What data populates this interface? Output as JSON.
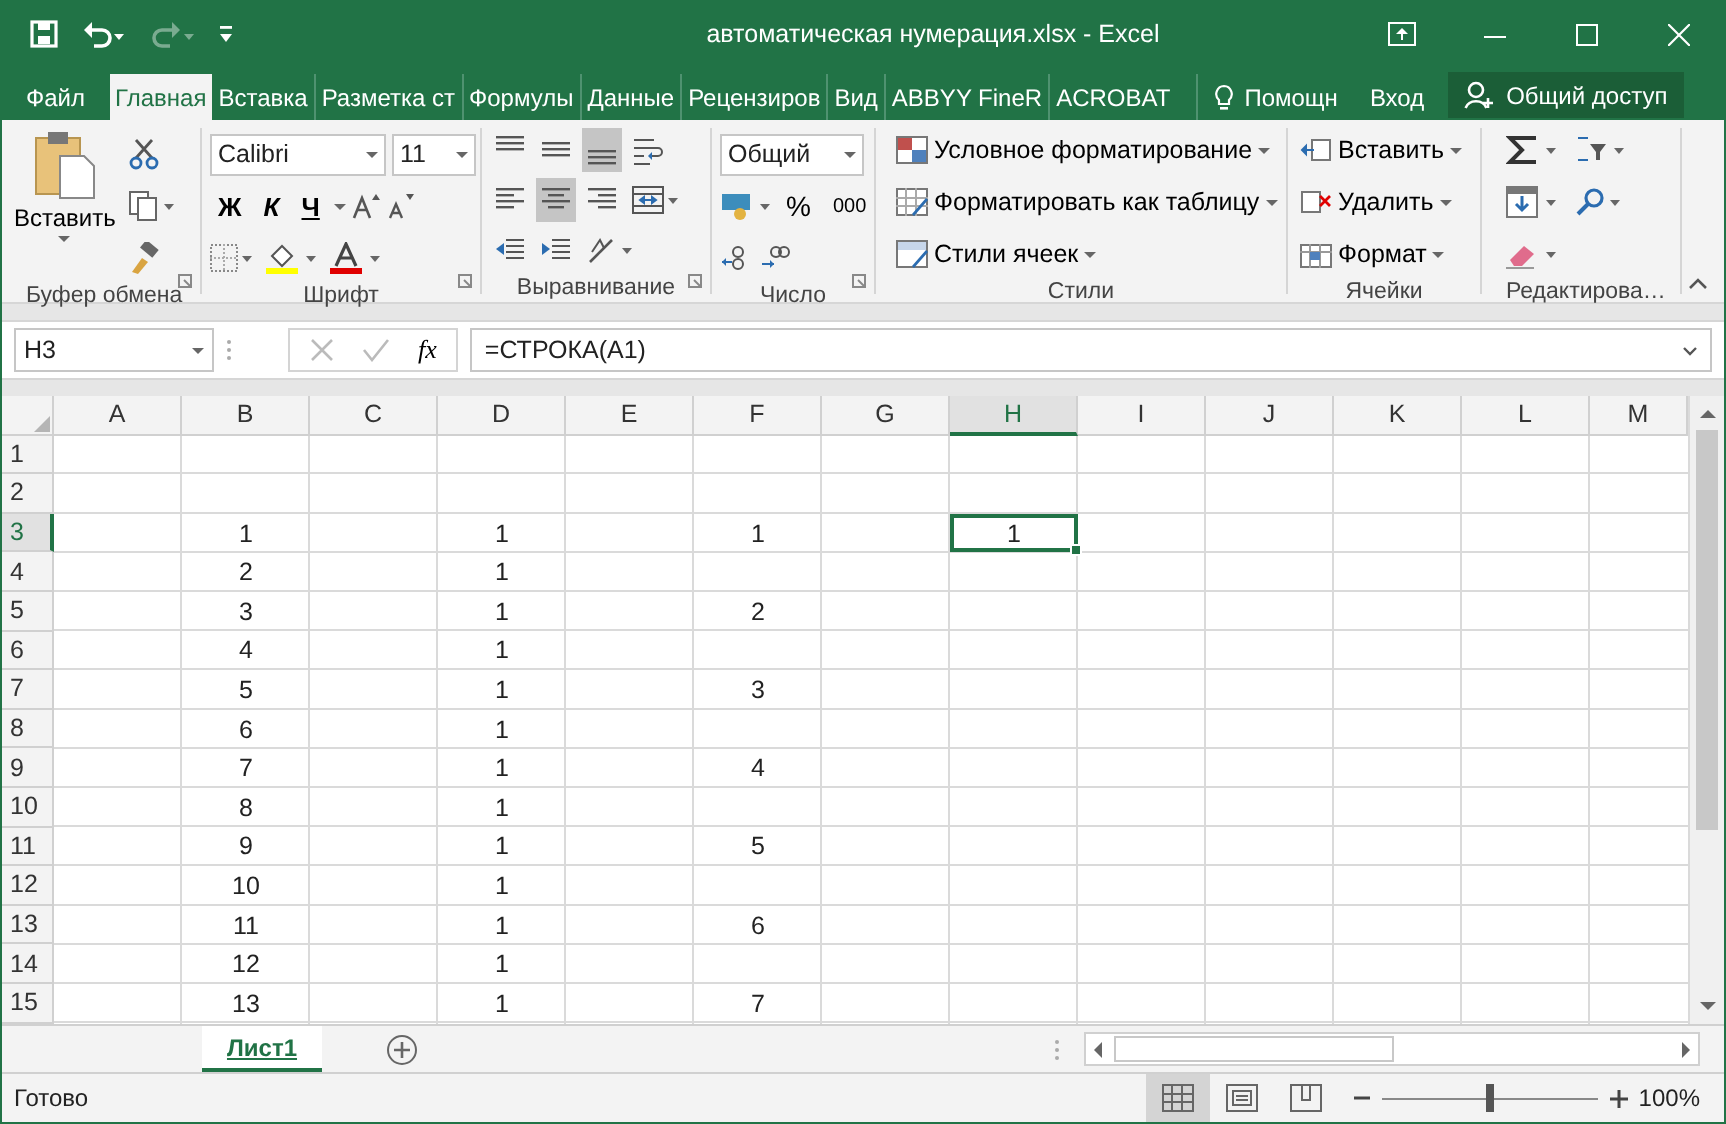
{
  "title_bar": {
    "title": "автоматическая нумерация.xlsx - Excel",
    "redo_disabled": true
  },
  "ribbon_tabs": [
    {
      "label": "Файл",
      "selected": false
    },
    {
      "label": "Главная",
      "selected": true
    },
    {
      "label": "Вставка",
      "selected": false
    },
    {
      "label": "Разметка ст",
      "selected": false
    },
    {
      "label": "Формулы",
      "selected": false
    },
    {
      "label": "Данные",
      "selected": false
    },
    {
      "label": "Рецензиров",
      "selected": false
    },
    {
      "label": "Вид",
      "selected": false
    },
    {
      "label": "ABBYY FineR",
      "selected": false
    },
    {
      "label": "ACROBAT",
      "selected": false
    }
  ],
  "tell_me": "Помощн",
  "sign_in": "Вход",
  "share": "Общий доступ",
  "ribbon": {
    "clipboard": {
      "paste": "Вставить",
      "label": "Буфер обмена"
    },
    "font": {
      "name": "Calibri",
      "size": "11",
      "bold": "Ж",
      "italic": "К",
      "underline": "Ч",
      "label": "Шрифт"
    },
    "alignment": {
      "vertical": [
        {
          "kind": "top",
          "selected": false
        },
        {
          "kind": "middle",
          "selected": false
        },
        {
          "kind": "bottom",
          "selected": true
        }
      ],
      "horizontal": [
        {
          "kind": "left",
          "selected": false
        },
        {
          "kind": "center",
          "selected": true
        },
        {
          "kind": "right",
          "selected": false
        }
      ],
      "label": "Выравнивание"
    },
    "number": {
      "format": "Общий",
      "percent": "%",
      "thousands": "000",
      "label": "Число"
    },
    "styles": {
      "items": [
        "Условное форматирование",
        "Форматировать как таблицу",
        "Стили ячеек"
      ],
      "label": "Стили"
    },
    "cells": {
      "items": [
        "Вставить",
        "Удалить",
        "Формат"
      ],
      "label": "Ячейки"
    },
    "editing": {
      "label": "Редактирова…"
    }
  },
  "formula_bar": {
    "name_box": "H3",
    "fx": "fx",
    "formula": "=СТРОКА(A1)"
  },
  "sheet": {
    "columns": [
      {
        "label": "A",
        "selected": false
      },
      {
        "label": "B",
        "selected": false
      },
      {
        "label": "C",
        "selected": false
      },
      {
        "label": "D",
        "selected": false
      },
      {
        "label": "E",
        "selected": false
      },
      {
        "label": "F",
        "selected": false
      },
      {
        "label": "G",
        "selected": false
      },
      {
        "label": "H",
        "selected": true
      },
      {
        "label": "I",
        "selected": false
      },
      {
        "label": "J",
        "selected": false
      },
      {
        "label": "K",
        "selected": false
      },
      {
        "label": "L",
        "selected": false
      },
      {
        "label": "M",
        "selected": false
      }
    ],
    "rows": [
      {
        "header": "1",
        "selected": false
      },
      {
        "header": "2",
        "selected": false
      },
      {
        "header": "3",
        "selected": true,
        "cells": {
          "b": {
            "value": "1",
            "selected": false
          },
          "d": {
            "value": "1",
            "selected": false
          },
          "f": {
            "value": "1",
            "selected": false
          },
          "h": {
            "value": "1",
            "selected": true
          }
        }
      },
      {
        "header": "4",
        "selected": false,
        "cells": {
          "b": {
            "value": "2",
            "selected": false
          },
          "d": {
            "value": "1",
            "selected": false
          }
        }
      },
      {
        "header": "5",
        "selected": false,
        "cells": {
          "b": {
            "value": "3",
            "selected": false
          },
          "d": {
            "value": "1",
            "selected": false
          },
          "f": {
            "value": "2",
            "selected": false
          }
        }
      },
      {
        "header": "6",
        "selected": false,
        "cells": {
          "b": {
            "value": "4",
            "selected": false
          },
          "d": {
            "value": "1",
            "selected": false
          }
        }
      },
      {
        "header": "7",
        "selected": false,
        "cells": {
          "b": {
            "value": "5",
            "selected": false
          },
          "d": {
            "value": "1",
            "selected": false
          },
          "f": {
            "value": "3",
            "selected": false
          }
        }
      },
      {
        "header": "8",
        "selected": false,
        "cells": {
          "b": {
            "value": "6",
            "selected": false
          },
          "d": {
            "value": "1",
            "selected": false
          }
        }
      },
      {
        "header": "9",
        "selected": false,
        "cells": {
          "b": {
            "value": "7",
            "selected": false
          },
          "d": {
            "value": "1",
            "selected": false
          },
          "f": {
            "value": "4",
            "selected": false
          }
        }
      },
      {
        "header": "10",
        "selected": false,
        "cells": {
          "b": {
            "value": "8",
            "selected": false
          },
          "d": {
            "value": "1",
            "selected": false
          }
        }
      },
      {
        "header": "11",
        "selected": false,
        "cells": {
          "b": {
            "value": "9",
            "selected": false
          },
          "d": {
            "value": "1",
            "selected": false
          },
          "f": {
            "value": "5",
            "selected": false
          }
        }
      },
      {
        "header": "12",
        "selected": false,
        "cells": {
          "b": {
            "value": "10",
            "selected": false
          },
          "d": {
            "value": "1",
            "selected": false
          }
        }
      },
      {
        "header": "13",
        "selected": false,
        "cells": {
          "b": {
            "value": "11",
            "selected": false
          },
          "d": {
            "value": "1",
            "selected": false
          },
          "f": {
            "value": "6",
            "selected": false
          }
        }
      },
      {
        "header": "14",
        "selected": false,
        "cells": {
          "b": {
            "value": "12",
            "selected": false
          },
          "d": {
            "value": "1",
            "selected": false
          }
        }
      },
      {
        "header": "15",
        "selected": false,
        "cells": {
          "b": {
            "value": "13",
            "selected": false
          },
          "d": {
            "value": "1",
            "selected": false
          },
          "f": {
            "value": "7",
            "selected": false
          }
        }
      }
    ]
  },
  "sheet_tabs": [
    {
      "label": "Лист1",
      "selected": true
    }
  ],
  "status_bar": {
    "status": "Готово",
    "views": [
      {
        "kind": "normal",
        "selected": true
      },
      {
        "kind": "page_layout",
        "selected": false
      },
      {
        "kind": "page_break",
        "selected": false
      }
    ],
    "zoom": {
      "level": 0.5
    },
    "zoom_text": "100%"
  }
}
